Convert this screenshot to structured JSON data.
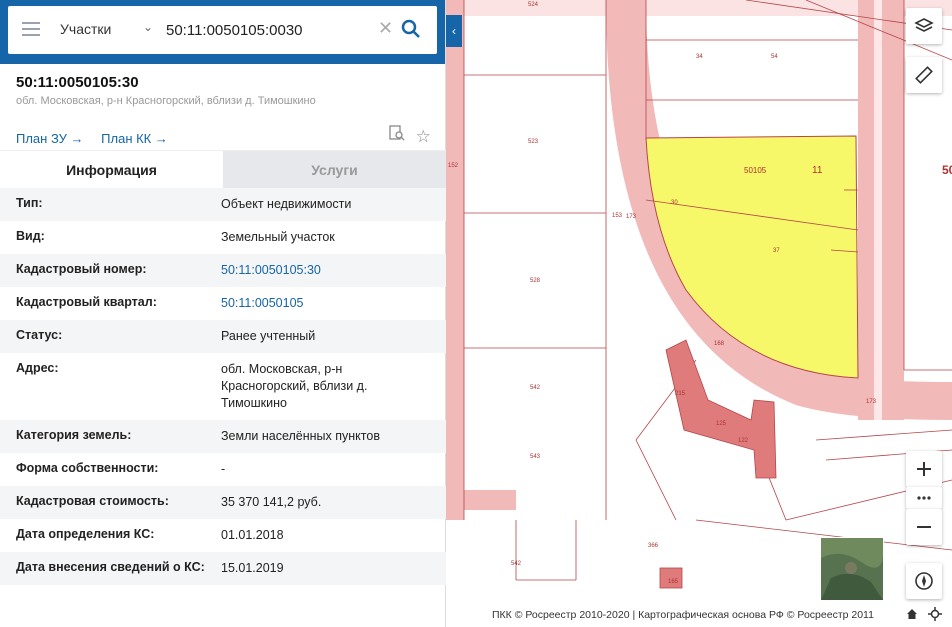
{
  "search": {
    "layer": "Участки",
    "query": "50:11:0050105:0030"
  },
  "parcel": {
    "title": "50:11:0050105:30",
    "address": "обл. Московская, р-н Красногорский, вблизи д. Тимошкино",
    "links": [
      "План ЗУ →",
      "План КК →"
    ]
  },
  "tabs": [
    "Информация",
    "Услуги"
  ],
  "info": [
    {
      "k": "Тип:",
      "v": "Объект недвижимости"
    },
    {
      "k": "Вид:",
      "v": "Земельный участок"
    },
    {
      "k": "Кадастровый номер:",
      "v": "50:11:0050105:30",
      "link": true
    },
    {
      "k": "Кадастровый квартал:",
      "v": "50:11:0050105",
      "link": true
    },
    {
      "k": "Статус:",
      "v": "Ранее учтенный"
    },
    {
      "k": "Адрес:",
      "v": "обл. Московская, р-н Красногорский, вблизи д. Тимошкино"
    },
    {
      "k": "Категория земель:",
      "v": "Земли населённых пунктов"
    },
    {
      "k": "Форма собственности:",
      "v": "-"
    },
    {
      "k": "Кадастровая стоимость:",
      "v": "35 370 141,2 руб."
    },
    {
      "k": "Дата определения КС:",
      "v": "01.01.2018"
    },
    {
      "k": "Дата внесения сведений о КС:",
      "v": "15.01.2019"
    }
  ],
  "map": {
    "labels": [
      "524",
      "34",
      "54",
      "523",
      "50105",
      "11",
      "50",
      "30",
      "37",
      "152",
      "153",
      "173",
      "528",
      "168",
      "542",
      "215",
      "125",
      "122",
      "543",
      "366",
      "542",
      "165",
      "173"
    ],
    "copyright": "ПКК © Росреестр 2010-2020 | Картографическая основа РФ © Росреестр 2011"
  },
  "colors": {
    "accent": "#1565a8",
    "parcel_fill": "#f7f76a",
    "road_fill": "#f2b9b9",
    "building": "#e07b7b",
    "boundary": "#b5454a"
  }
}
